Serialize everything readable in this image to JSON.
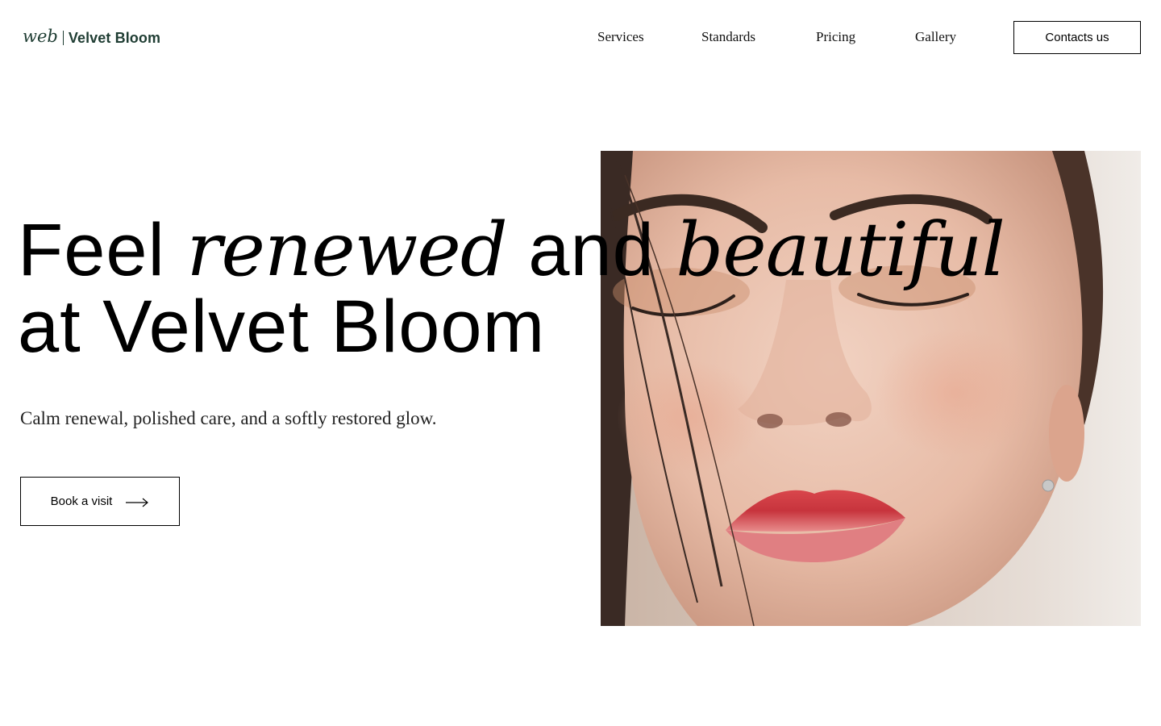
{
  "brand": {
    "script": "web",
    "name": "Velvet Bloom"
  },
  "nav": {
    "items": [
      "Services",
      "Standards",
      "Pricing",
      "Gallery"
    ],
    "contact_label": "Contacts us"
  },
  "hero": {
    "headline": {
      "part1": "Feel ",
      "part2_italic": "renewed",
      "part3": " and ",
      "part4_italic": "beautiful",
      "line2": "at Velvet Bloom"
    },
    "subtitle": "Calm renewal, polished care, and a softly restored glow.",
    "cta_label": "Book a visit",
    "cta_icon": "arrow-right-icon",
    "photo_alt": "close-up portrait of woman with eyes closed"
  },
  "colors": {
    "brand": "#1f3d33",
    "text": "#000000",
    "background": "#ffffff"
  }
}
